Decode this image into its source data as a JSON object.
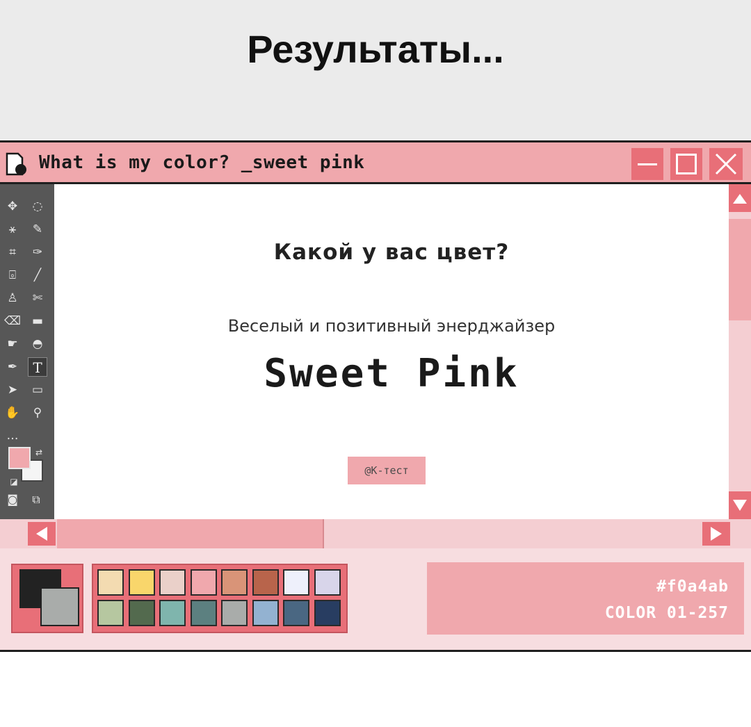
{
  "page": {
    "heading": "Результаты..."
  },
  "window": {
    "title": "What is my color? _sweet pink",
    "controls": {
      "minimize": "minimize-icon",
      "maximize": "maximize-icon",
      "close": "close-icon"
    }
  },
  "content": {
    "question": "Какой у вас цвет?",
    "subtitle": "Веселый и позитивный энерджайзер",
    "color_name": "Sweet Pink",
    "credit": "@К-тест"
  },
  "toolbar": {
    "tools": [
      {
        "name": "move-icon",
        "glyph": "✥"
      },
      {
        "name": "lasso-select-icon",
        "glyph": "◌"
      },
      {
        "name": "magic-wand-icon",
        "glyph": "⚹"
      },
      {
        "name": "quick-select-icon",
        "glyph": "✎"
      },
      {
        "name": "crop-icon",
        "glyph": "⌗"
      },
      {
        "name": "eyedropper-icon",
        "glyph": "✑"
      },
      {
        "name": "frame-icon",
        "glyph": "⌻"
      },
      {
        "name": "brush-icon",
        "glyph": "╱"
      },
      {
        "name": "stamp-icon",
        "glyph": "♙"
      },
      {
        "name": "healing-icon",
        "glyph": "✄"
      },
      {
        "name": "eraser-icon",
        "glyph": "⌫"
      },
      {
        "name": "gradient-icon",
        "glyph": "▬"
      },
      {
        "name": "blur-icon",
        "glyph": "☛"
      },
      {
        "name": "dodge-icon",
        "glyph": "◓"
      },
      {
        "name": "pen-icon",
        "glyph": "✒"
      },
      {
        "name": "text-tool-icon",
        "glyph": "T"
      },
      {
        "name": "path-select-icon",
        "glyph": "➤"
      },
      {
        "name": "rectangle-icon",
        "glyph": "▭"
      },
      {
        "name": "hand-icon",
        "glyph": "✋"
      },
      {
        "name": "zoom-icon",
        "glyph": "⚲"
      },
      {
        "name": "more-tools-icon",
        "glyph": "…"
      }
    ],
    "foreground_color": "#f0a8ad",
    "background_color": "#f5f5f5"
  },
  "palette": {
    "foreground": "#222222",
    "background": "#a9acaa",
    "swatches": [
      "#f3dbb1",
      "#f9d66b",
      "#ead0c9",
      "#f0a8ad",
      "#d99478",
      "#b8644b",
      "#eef0fb",
      "#d8d5ea",
      "#b6c7a0",
      "#536a4e",
      "#7fb5ad",
      "#5c8080",
      "#a9acaa",
      "#93b2d1",
      "#4a6782",
      "#283d61"
    ]
  },
  "color_info": {
    "hex": "#f0a4ab",
    "code": "COLOR 01-257"
  }
}
